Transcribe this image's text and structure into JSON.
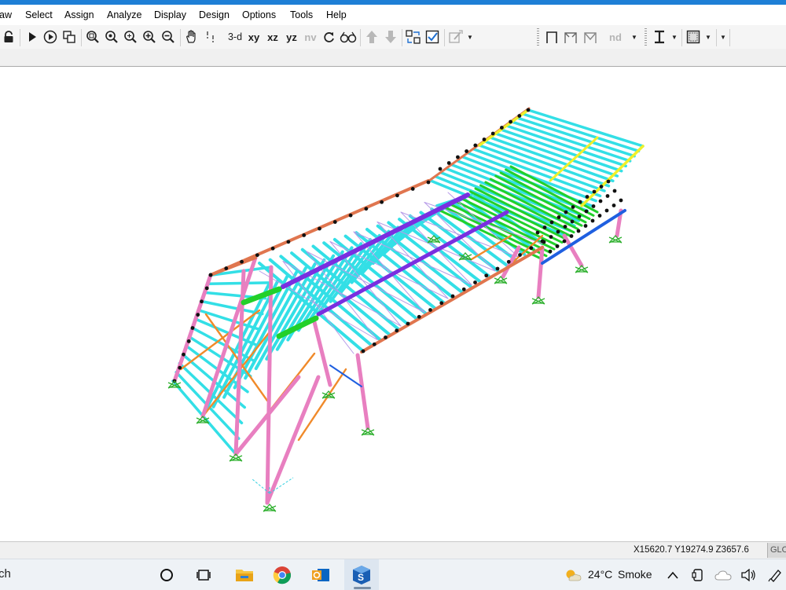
{
  "menu": {
    "items": [
      "aw",
      "Select",
      "Assign",
      "Analyze",
      "Display",
      "Design",
      "Options",
      "Tools",
      "Help"
    ]
  },
  "toolbar": {
    "view_3d": "3-d",
    "view_xy": "xy",
    "view_xz": "xz",
    "view_yz": "yz",
    "view_nv": "nv",
    "nd_label": "nd"
  },
  "status": {
    "coordinates": "X15620.7  Y19274.9  Z3657.6",
    "coord_system": "GLO"
  },
  "taskbar": {
    "search_text": "ch",
    "weather_temp": "24°C",
    "weather_desc": "Smoke"
  },
  "colors": {
    "purlin": "#33dfe6",
    "rafter_top": "#e0764f",
    "column": "#e87fc0",
    "bracing": "#f08a2a",
    "beam_purple": "#7a2fe0",
    "beam_green": "#22d02a",
    "beam_yellow": "#f0f02a",
    "beam_blue": "#1f5fe0",
    "support": "#2fb02f",
    "accent": "#1e7fd6"
  }
}
